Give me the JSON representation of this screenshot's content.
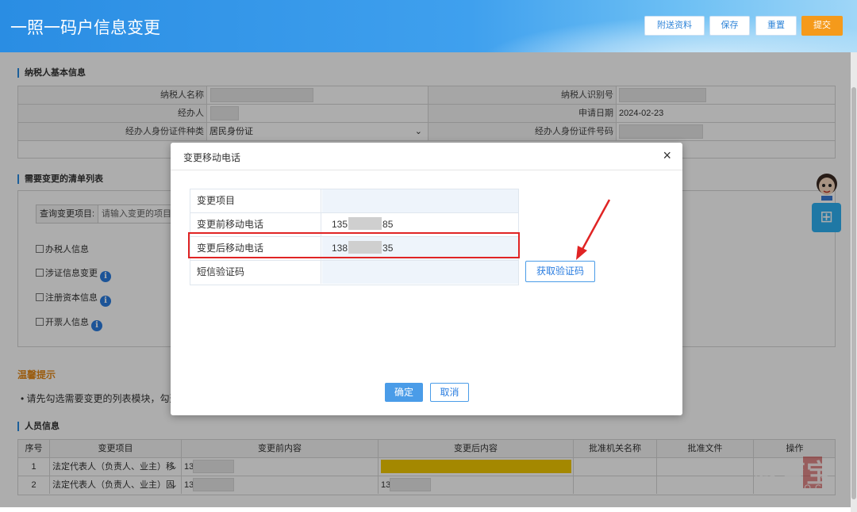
{
  "header": {
    "title": "一照一码户信息变更",
    "buttons": {
      "attach": "附送资料",
      "save": "保存",
      "reset": "重置",
      "submit": "提交"
    }
  },
  "basic_info": {
    "section_title": "纳税人基本信息",
    "taxpayer_name_label": "纳税人名称",
    "taxpayer_id_label": "纳税人识别号",
    "agent_label": "经办人",
    "apply_date_label": "申请日期",
    "apply_date_value": "2024-02-23",
    "id_type_label": "经办人身份证件种类",
    "id_type_value": "居民身份证",
    "id_number_label": "经办人身份证件号码"
  },
  "change_list": {
    "section_title": "需要变更的清单列表",
    "query_label": "查询变更项目:",
    "query_placeholder": "请输入变更的项目",
    "checkboxes": [
      "办税人信息",
      "涉证信息变更",
      "注册资本信息",
      "开票人信息"
    ]
  },
  "warm_tip": {
    "title": "温馨提示",
    "text": "• 请先勾选需要变更的列表模块，勾选"
  },
  "personnel": {
    "section_title": "人员信息",
    "headers": [
      "序号",
      "变更项目",
      "变更前内容",
      "变更后内容",
      "批准机关名称",
      "批准文件",
      "操作"
    ],
    "rows": [
      {
        "no": "1",
        "item": "法定代表人（负责人、业主）移",
        "before": "13",
        "after": ""
      },
      {
        "no": "2",
        "item": "法定代表人（负责人、业主）固",
        "before": "13",
        "after": "13"
      }
    ]
  },
  "modal": {
    "title": "变更移动电话",
    "close": "×",
    "rows": [
      {
        "label": "变更项目",
        "value_prefix": "",
        "value_suffix": ""
      },
      {
        "label": "变更前移动电话",
        "value_prefix": "135",
        "value_suffix": "85"
      },
      {
        "label": "变更后移动电话",
        "value_prefix": "138",
        "value_suffix": "35"
      },
      {
        "label": "短信验证码",
        "value_prefix": "",
        "value_suffix": ""
      }
    ],
    "get_code_button": "获取验证码",
    "ok_button": "确定",
    "cancel_button": "取消"
  },
  "assistant_glyph": "☺",
  "assist_button_glyph": "⊞",
  "watermark": {
    "text": "教育宝",
    "url": "JIAOYUBAO.CN"
  },
  "colors": {
    "accent": "#2a8de3",
    "submit": "#f59a1b",
    "highlight": "#e02424"
  }
}
